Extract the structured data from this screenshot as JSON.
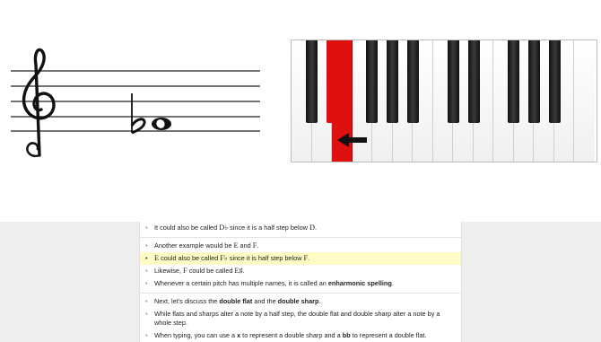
{
  "notation": {
    "clef": "treble-clef",
    "accidental": "♭",
    "note": "whole-note"
  },
  "keyboard": {
    "white_key_count": 15,
    "highlighted_key": "F flat (E)",
    "arrow": "left-arrow-icon"
  },
  "notes": {
    "n0": {
      "a": "It could also be called ",
      "b": "D♭",
      "c": " since it is a half step below ",
      "d": "D",
      "e": "."
    },
    "n1": {
      "a": "Another example would be ",
      "b": "E",
      "c": " and ",
      "d": "F",
      "e": "."
    },
    "n2": {
      "a": "",
      "b": "E",
      "c": " could also be called ",
      "d": "F♭",
      "e": " since it is half step below ",
      "f": "F",
      "g": "."
    },
    "n3": {
      "a": "Likewise, ",
      "b": "F",
      "c": " could be called ",
      "d": "E♯",
      "e": "."
    },
    "n4": {
      "a": "Whenever a certain pitch has multiple names, it is called an ",
      "b": "enharmonic spelling",
      "c": "."
    },
    "n5": {
      "a": "Next, let's discuss the ",
      "b": "double flat",
      "c": " and the ",
      "d": "double sharp",
      "e": "."
    },
    "n6": {
      "a": "While flats and sharps alter a note by a half step, the double flat and double sharp alter a note by a whole step."
    },
    "n7": {
      "a": "When typing, you can use a ",
      "b": "x",
      "c": " to represent a double sharp and a ",
      "d": "bb",
      "e": " to represent a double flat."
    }
  },
  "bullet": "•"
}
